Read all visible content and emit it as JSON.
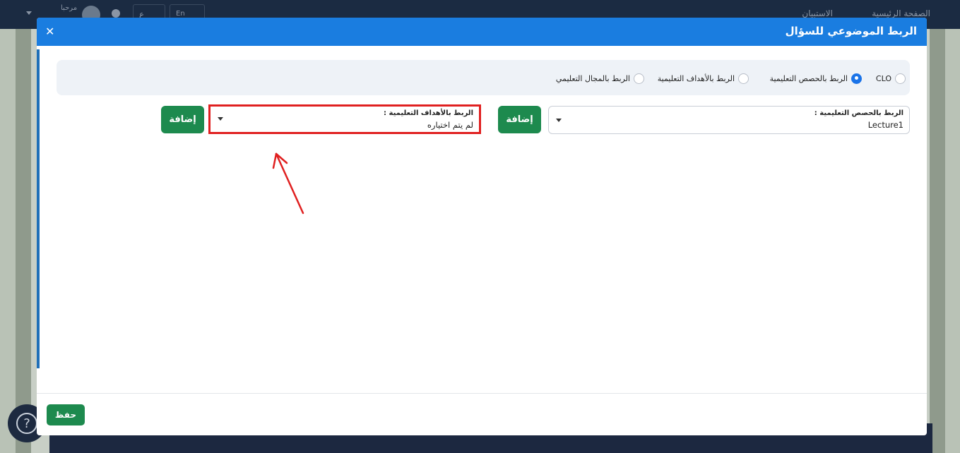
{
  "topbar": {
    "home_label": "الصفحة الرئيسية",
    "survey_label": "الاستبيان",
    "greeting": "مرحبا",
    "lang_en": "En",
    "lang_ar": "ع"
  },
  "modal": {
    "title": "الربط الموضوعي للسؤال",
    "close_icon": "close-icon"
  },
  "radio_options": [
    {
      "label": "CLO",
      "selected": false
    },
    {
      "label": "الربط بالحصص التعليمية",
      "selected": true
    },
    {
      "label": "الربط بالأهداف التعليمية",
      "selected": false
    },
    {
      "label": "الربط بالمجال التعليمي",
      "selected": false
    }
  ],
  "lectures_select": {
    "label": "الربط بالحصص التعليمية :",
    "value": "Lecture1"
  },
  "objectives_select": {
    "label": "الربط بالأهداف التعليمية :",
    "value": "لم يتم اختياره"
  },
  "add_button_label": "إضافة",
  "save_button_label": "حفظ",
  "help_label": "?",
  "colors": {
    "header": "#1a7de0",
    "add_button": "#1d8a4e",
    "highlight": "#e02020",
    "radio_selected": "#1a73e8"
  }
}
